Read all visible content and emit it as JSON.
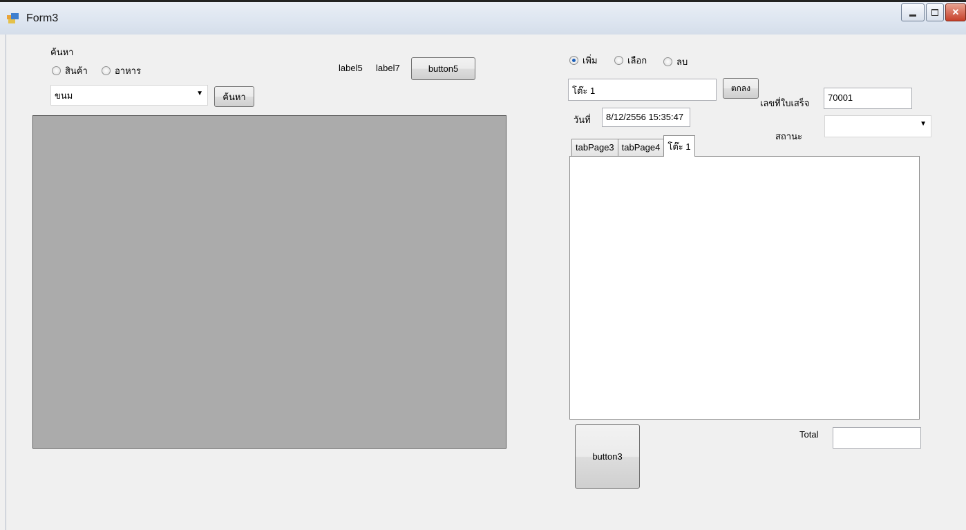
{
  "window": {
    "title": "Form3"
  },
  "search": {
    "group_label": "ค้นหา",
    "radio_product": "สินค้า",
    "radio_food": "อาหาร",
    "combo_value": "ขนม",
    "search_button": "ค้นหา"
  },
  "top": {
    "label5": "label5",
    "label7": "label7",
    "button5": "button5"
  },
  "mode": {
    "add": "เพิ่ม",
    "select": "เลือก",
    "delete": "ลบ",
    "selected": "add"
  },
  "table": {
    "value": "โต๊ะ 1",
    "ok_button": "ตกลง"
  },
  "receipt": {
    "label": "เลขที่ใบเสร็จ",
    "value": "70001"
  },
  "date": {
    "label": "วันที่",
    "value": "8/12/2556 15:35:47"
  },
  "status": {
    "label": "สถานะ",
    "value": ""
  },
  "tabs": [
    "tabPage3",
    "tabPage4",
    "โต๊ะ 1"
  ],
  "bottom": {
    "button3": "button3",
    "total_label": "Total",
    "total_value": ""
  }
}
